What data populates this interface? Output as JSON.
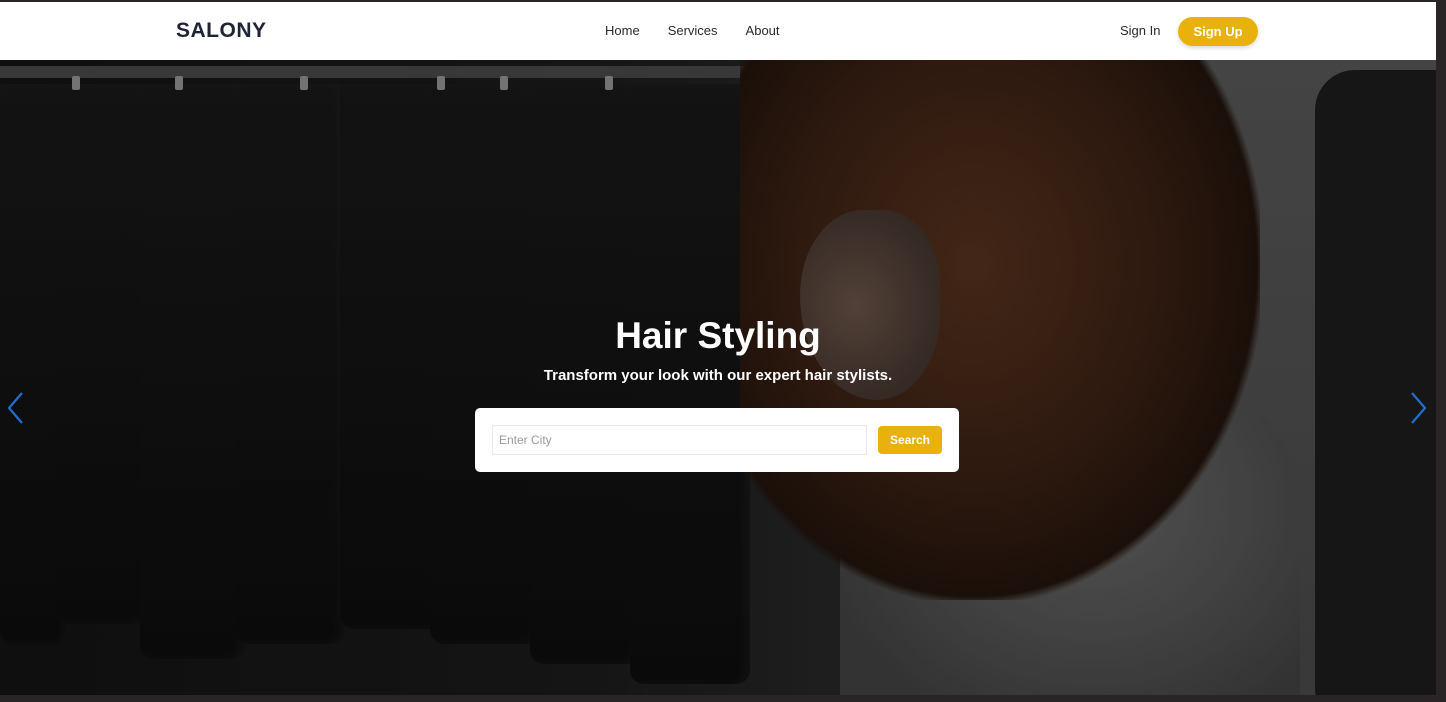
{
  "colors": {
    "accent": "#e9b10b",
    "brand_text": "#1f2333",
    "carousel_arrow": "#1f6fd6"
  },
  "navbar": {
    "brand": "SALONY",
    "links": [
      "Home",
      "Services",
      "About"
    ],
    "sign_in": "Sign In",
    "sign_up": "Sign Up"
  },
  "hero": {
    "title": "Hair Styling",
    "subtitle": "Transform your look with our expert hair stylists.",
    "search": {
      "placeholder": "Enter City",
      "value": "",
      "button": "Search"
    },
    "carousel": {
      "prev_icon": "chevron-left-icon",
      "next_icon": "chevron-right-icon"
    }
  }
}
